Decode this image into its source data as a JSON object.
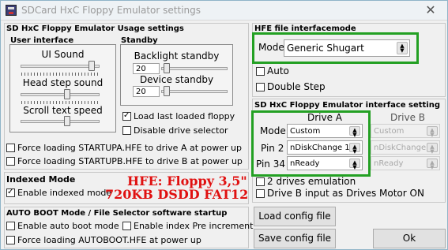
{
  "window": {
    "title": "SDCard HxC Floppy Emulator settings",
    "close_glyph": "✕"
  },
  "usage": {
    "title": "SD HxC Floppy Emulator Usage settings",
    "ui_title": "User interface",
    "standby_title": "Standby",
    "ui_sound": "UI Sound",
    "head_step_sound": "Head step sound",
    "scroll_text_speed": "Scroll text speed",
    "backlight_standby": "Backlight standby",
    "backlight_value": "20",
    "device_standby": "Device standby",
    "device_value": "20",
    "load_last": "Load last loaded floppy",
    "disable_drive_selector": "Disable drive selector",
    "force_a": "Force loading STARTUPA.HFE to drive A at power up",
    "force_b": "Force loading STARTUPB.HFE to drive B at power up"
  },
  "indexed": {
    "title": "Indexed Mode",
    "enable": "Enable indexed mode"
  },
  "annotation": {
    "line1": "HFE: Floppy 3,5\"",
    "line2": "720KB DSDD FAT12",
    "color": "#e01010"
  },
  "autoboot": {
    "title": "AUTO BOOT Mode / File Selector software startup",
    "enable_auto": "Enable auto boot mode",
    "enable_index_pre": "Enable index Pre increment",
    "force_autoboot": "Force loading AUTOBOOT.HFE at power up"
  },
  "hfe": {
    "title": "HFE file interfacemode",
    "mode_label": "Mode",
    "mode_value": "Generic Shugart",
    "auto": "Auto",
    "double_step": "Double Step"
  },
  "interface": {
    "title": "SD HxC Floppy Emulator interface setting",
    "drive_a": "Drive A",
    "drive_b": "Drive B",
    "rows": [
      {
        "label": "Mode",
        "a": "Custom",
        "b": "Custom"
      },
      {
        "label": "Pin 2",
        "a": "nDiskChange 1",
        "b": "nDiskChange 1"
      },
      {
        "label": "Pin 34",
        "a": "nReady",
        "b": "nReady"
      }
    ],
    "two_drives": "2 drives emulation",
    "motor_on": "Drive B input as Drives Motor ON"
  },
  "buttons": {
    "load": "Load config file",
    "save": "Save config file",
    "ok": "Ok"
  },
  "colors": {
    "highlight": "#23a023"
  }
}
